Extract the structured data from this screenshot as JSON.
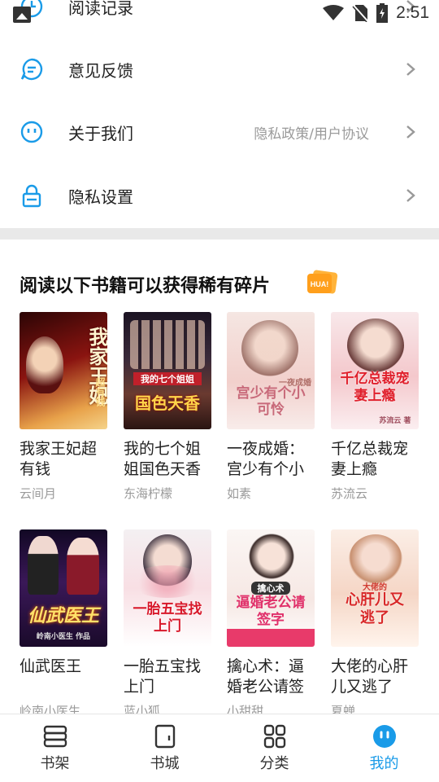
{
  "status_bar": {
    "time": "2:51"
  },
  "menu": {
    "reading_history": "阅读记录",
    "feedback": "意见反馈",
    "about": "关于我们",
    "about_sub": "隐私政策/用户协议",
    "privacy": "隐私设置"
  },
  "section": {
    "title": "阅读以下书籍可以获得稀有碎片",
    "badge_text": "HUA!"
  },
  "books": [
    {
      "title": "我家王妃超有钱",
      "author": "云间月",
      "cover_text": "我家王妃",
      "cover_sub": "超有钱"
    },
    {
      "title": "我的七个姐姐国色天香",
      "author": "东海柠檬",
      "cover_text": "国色天香",
      "cover_sub": "我的七个姐姐"
    },
    {
      "title": "一夜成婚：宫少有个小可怜",
      "author": "如素",
      "cover_text": "宫少有个小可怜",
      "cover_sub": "一夜成婚"
    },
    {
      "title": "千亿总裁宠妻上瘾",
      "author": "苏流云",
      "cover_text": "千亿总裁宠妻上瘾",
      "cover_sub": "苏流云 著"
    },
    {
      "title": "仙武医王",
      "author": "岭南小医生",
      "cover_text": "仙武医王",
      "cover_sub": "岭南小医生 作品"
    },
    {
      "title": "一胎五宝找上门",
      "author": "蓝小狐",
      "cover_text": "一胎五宝找上门",
      "cover_sub": ""
    },
    {
      "title": "擒心术：逼婚老公请签字",
      "author": "小甜甜",
      "cover_text": "逼婚老公请签字",
      "cover_sub": "擒心术"
    },
    {
      "title": "大佬的心肝儿又逃了",
      "author": "夏蝉",
      "cover_text": "心肝儿又逃了",
      "cover_sub": "大佬的"
    }
  ],
  "bottom_nav": {
    "bookshelf": "书架",
    "bookstore": "书城",
    "category": "分类",
    "mine": "我的"
  },
  "colors": {
    "accent": "#1a9be8"
  }
}
